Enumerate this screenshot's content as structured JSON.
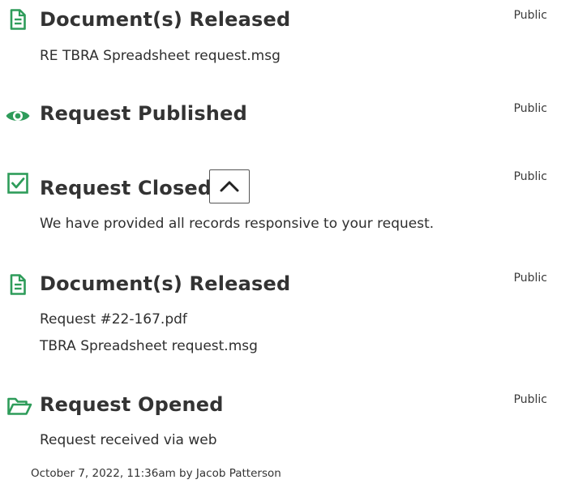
{
  "timeline": [
    {
      "icon": "document-icon",
      "title": "Document(s) Released",
      "visibility": "Public",
      "lines": [
        "RE TBRA Spreadsheet request.msg"
      ]
    },
    {
      "icon": "eye-icon",
      "title": "Request Published",
      "visibility": "Public",
      "lines": []
    },
    {
      "icon": "checkbox-icon",
      "title": "Request Closed",
      "visibility": "Public",
      "lines": [
        "We have provided all records responsive to your request."
      ]
    },
    {
      "icon": "document-icon",
      "title": "Document(s) Released",
      "visibility": "Public",
      "lines": [
        "Request #22-167.pdf",
        "TBRA Spreadsheet request.msg"
      ]
    },
    {
      "icon": "folder-open-icon",
      "title": "Request Opened",
      "visibility": "Public",
      "lines": [
        "Request received via web"
      ]
    }
  ],
  "footer": {
    "meta": "October 7, 2022, 11:36am by Jacob Patterson"
  },
  "colors": {
    "accent": "#2e9c5a"
  }
}
